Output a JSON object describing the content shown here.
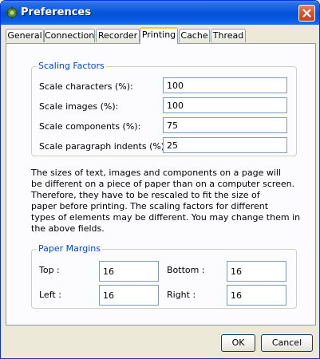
{
  "window": {
    "title": "Preferences",
    "icon": "app-icon"
  },
  "tabs": [
    {
      "label": "General",
      "active": false
    },
    {
      "label": "Connection",
      "active": false
    },
    {
      "label": "Recorder",
      "active": false
    },
    {
      "label": "Printing",
      "active": true
    },
    {
      "label": "Cache",
      "active": false
    },
    {
      "label": "Thread",
      "active": false
    }
  ],
  "scaling": {
    "title": "Scaling Factors",
    "rows": [
      {
        "label": "Scale characters (%):",
        "value": "100"
      },
      {
        "label": "Scale images (%):",
        "value": "100"
      },
      {
        "label": "Scale components (%):",
        "value": "75"
      },
      {
        "label": "Scale paragraph indents (%):",
        "value": "25"
      }
    ]
  },
  "description": [
    "The sizes of text, images and components on a page will",
    "be different on a piece of paper than on a computer screen.",
    "Therefore, they have to be rescaled to fit the size of",
    "paper before printing. The scaling factors for different",
    "types of elements may be different. You may change them in",
    "the above fields."
  ],
  "margins": {
    "title": "Paper Margins",
    "top": {
      "label": "Top :",
      "value": "16"
    },
    "bottom": {
      "label": "Bottom :",
      "value": "16"
    },
    "left": {
      "label": "Left :",
      "value": "16"
    },
    "right": {
      "label": "Right :",
      "value": "16"
    }
  },
  "buttons": {
    "ok": "OK",
    "cancel": "Cancel"
  },
  "colors": {
    "titlebar": "#0a58e0",
    "group_title": "#0046d5",
    "active_tab_accent": "#ffc83c",
    "close_button": "#d9552f"
  }
}
